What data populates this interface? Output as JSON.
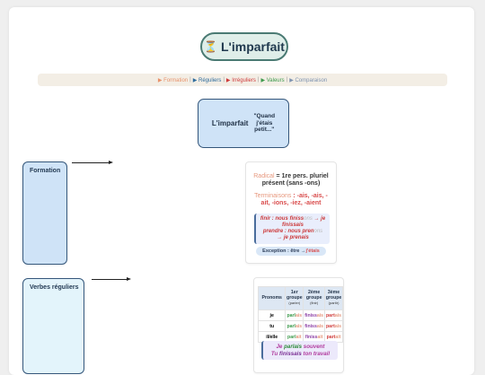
{
  "title": {
    "icon": "hourglass-icon",
    "glyph": "⏳",
    "text": "L'imparfait"
  },
  "nav": {
    "items": [
      "▶ Formation",
      "▶ Réguliers",
      "▶ Irréguliers",
      "▶ Valeurs",
      "▶ Comparaison"
    ],
    "separator": "|"
  },
  "center": {
    "label": "L'imparfait",
    "quote_l1": "\"Quand",
    "quote_l2": "j'étais",
    "quote_l3": "petit...\""
  },
  "sections": {
    "formation": {
      "label": "Formation",
      "color": "#cfe3f7"
    },
    "reguliers": {
      "label": "Verbes réguliers",
      "color": "#e3f4fb"
    }
  },
  "formation_panel": {
    "radical_word": "Radical",
    "radical_rest_1": " = 1re pers. pluriel",
    "radical_rest_2": "présent (sans -ons)",
    "term_word": "Terminaisons",
    "term_rest_1": " : -ais, -ais, -",
    "term_rest_2": "ait, -ions, -iez, -aient",
    "ex_1a": "finir : nous finiss",
    "ex_1b": "ons",
    "ex_1c": " → je",
    "ex_2": "finissais",
    "ex_3a": "prendre : nous pren",
    "ex_3b": "ons",
    "ex_4": "→ je prenais",
    "exception_text": "Exception : être → ",
    "exception_value": "j'étais"
  },
  "reguliers_panel": {
    "headers": {
      "pronoms": "Pronoms",
      "g1_l1": "1er",
      "g1_l2": "groupe",
      "g1_sub": "(parler)",
      "g2_l1": "2ème",
      "g2_l2": "groupe",
      "g2_sub": "(finir)",
      "g3_l1": "3ème",
      "g3_l2": "groupe",
      "g3_sub": "(partir)"
    },
    "rows": [
      {
        "pron": "je",
        "g1_stem": "parl",
        "g1_end": "ais",
        "g2_stem": "finiss",
        "g2_end": "ais",
        "g3_stem": "part",
        "g3_end": "ais"
      },
      {
        "pron": "tu",
        "g1_stem": "parl",
        "g1_end": "ais",
        "g2_stem": "finiss",
        "g2_end": "ais",
        "g3_stem": "part",
        "g3_end": "ais"
      },
      {
        "pron": "il/elle",
        "g1_stem": "parl",
        "g1_end": "ait",
        "g2_stem": "finiss",
        "g2_end": "ait",
        "g3_stem": "part",
        "g3_end": "ait"
      }
    ],
    "note_1a": "Je ",
    "note_1b": "parlais",
    "note_1c": " souvent",
    "note_2a": "Tu ",
    "note_2b": "finissais",
    "note_2c": " ton travail"
  }
}
